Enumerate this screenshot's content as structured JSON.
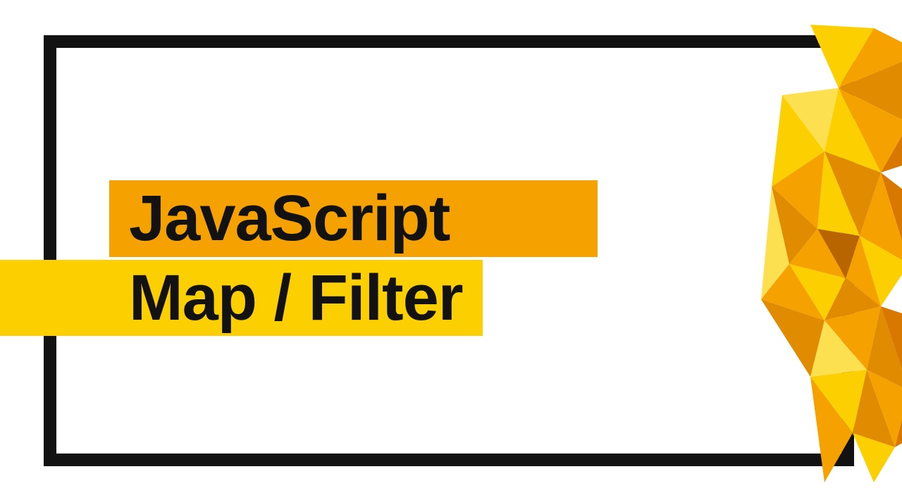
{
  "title": {
    "line1": "JavaScript",
    "line2": "Map / Filter"
  },
  "colors": {
    "frame": "#121212",
    "highlight1": "#f5a100",
    "highlight2": "#fccf00",
    "text": "#121212"
  }
}
